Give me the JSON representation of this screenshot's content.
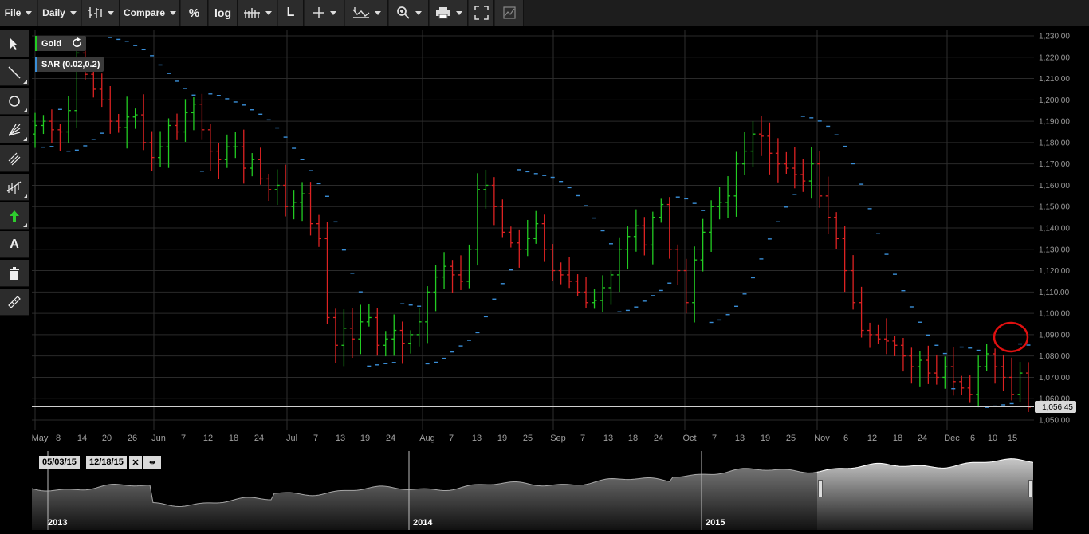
{
  "toolbar": {
    "file": "File",
    "period": "Daily",
    "compare": "Compare",
    "percent": "%",
    "log": "log",
    "line_tool": "L"
  },
  "legend": {
    "symbol": "Gold",
    "indicator": "SAR (0.02,0.2)",
    "symbol_color": "#22cc22",
    "indicator_color": "#3a8fd8"
  },
  "left_tools": {
    "text_tool": "A"
  },
  "price_axis": {
    "labels": [
      "1,230.00",
      "1,220.00",
      "1,210.00",
      "1,200.00",
      "1,190.00",
      "1,180.00",
      "1,170.00",
      "1,160.00",
      "1,150.00",
      "1,140.00",
      "1,130.00",
      "1,120.00",
      "1,110.00",
      "1,100.00",
      "1,090.00",
      "1,080.00",
      "1,070.00",
      "1,060.00",
      "1,050.00"
    ],
    "current_price": "1,056.45"
  },
  "date_axis": [
    {
      "label": "May",
      "month": true
    },
    {
      "label": "8"
    },
    {
      "label": "14"
    },
    {
      "label": "20"
    },
    {
      "label": "26"
    },
    {
      "label": "Jun",
      "month": true
    },
    {
      "label": "7"
    },
    {
      "label": "12"
    },
    {
      "label": "18"
    },
    {
      "label": "24"
    },
    {
      "label": "Jul",
      "month": true
    },
    {
      "label": "7"
    },
    {
      "label": "13"
    },
    {
      "label": "19"
    },
    {
      "label": "24"
    },
    {
      "label": "Aug",
      "month": true
    },
    {
      "label": "7"
    },
    {
      "label": "13"
    },
    {
      "label": "19"
    },
    {
      "label": "25"
    },
    {
      "label": "Sep",
      "month": true
    },
    {
      "label": "7"
    },
    {
      "label": "13"
    },
    {
      "label": "18"
    },
    {
      "label": "24"
    },
    {
      "label": "Oct",
      "month": true
    },
    {
      "label": "7"
    },
    {
      "label": "13"
    },
    {
      "label": "19"
    },
    {
      "label": "25"
    },
    {
      "label": "Nov",
      "month": true
    },
    {
      "label": "6"
    },
    {
      "label": "12"
    },
    {
      "label": "18"
    },
    {
      "label": "24"
    },
    {
      "label": "Dec",
      "month": true
    },
    {
      "label": "6"
    },
    {
      "label": "10"
    },
    {
      "label": "15"
    }
  ],
  "navigator": {
    "from_date": "05/03/15",
    "to_date": "12/18/15",
    "years": [
      "2013",
      "2014",
      "2015"
    ]
  },
  "colors": {
    "up": "#22cc22",
    "down": "#dd2222",
    "sar": "#3a8fd8",
    "grid": "#2a2a2a",
    "highlight_circle": "#e01010"
  },
  "chart_data": {
    "type": "ohlc",
    "symbol": "Gold",
    "period": "Daily",
    "x_range": [
      "May 2015",
      "Dec 2015"
    ],
    "ylim": [
      1045,
      1232
    ],
    "closes_approx": [
      1188,
      1190,
      1186,
      1185,
      1195,
      1222,
      1212,
      1205,
      1200,
      1190,
      1187,
      1192,
      1193,
      1180,
      1173,
      1178,
      1188,
      1185,
      1194,
      1198,
      1186,
      1176,
      1172,
      1178,
      1178,
      1168,
      1172,
      1163,
      1158,
      1160,
      1150,
      1152,
      1156,
      1142,
      1135,
      1098,
      1085,
      1093,
      1088,
      1096,
      1098,
      1085,
      1088,
      1092,
      1086,
      1090,
      1096,
      1110,
      1117,
      1122,
      1118,
      1115,
      1130,
      1158,
      1160,
      1150,
      1138,
      1133,
      1130,
      1135,
      1142,
      1130,
      1120,
      1118,
      1115,
      1110,
      1105,
      1106,
      1112,
      1118,
      1130,
      1136,
      1141,
      1132,
      1145,
      1151,
      1130,
      1120,
      1105,
      1125,
      1138,
      1150,
      1152,
      1155,
      1170,
      1176,
      1184,
      1183,
      1175,
      1170,
      1168,
      1165,
      1162,
      1170,
      1155,
      1145,
      1135,
      1120,
      1105,
      1092,
      1090,
      1088,
      1087,
      1085,
      1080,
      1075,
      1078,
      1072,
      1070,
      1075,
      1068,
      1065,
      1062,
      1075,
      1081,
      1075,
      1070,
      1062,
      1072,
      1056
    ]
  }
}
